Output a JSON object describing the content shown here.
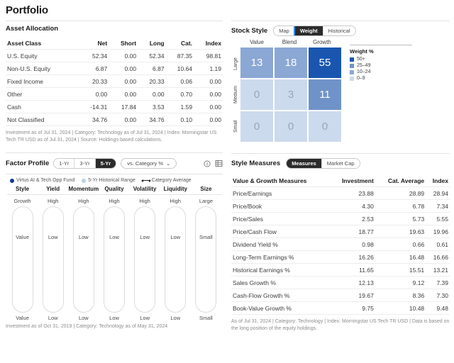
{
  "page": {
    "title": "Portfolio"
  },
  "asset_allocation": {
    "title": "Asset Allocation",
    "columns": [
      "Asset Class",
      "Net",
      "Short",
      "Long",
      "Cat.",
      "Index"
    ],
    "rows": [
      {
        "label": "U.S. Equity",
        "net": "52.34",
        "short": "0.00",
        "long": "52.34",
        "cat": "87.35",
        "index": "98.81"
      },
      {
        "label": "Non-U.S. Equity",
        "net": "6.87",
        "short": "0.00",
        "long": "6.87",
        "cat": "10.64",
        "index": "1.19"
      },
      {
        "label": "Fixed Income",
        "net": "20.33",
        "short": "0.00",
        "long": "20.33",
        "cat": "0.06",
        "index": "0.00"
      },
      {
        "label": "Other",
        "net": "0.00",
        "short": "0.00",
        "long": "0.00",
        "cat": "0.70",
        "index": "0.00"
      },
      {
        "label": "Cash",
        "net": "-14.31",
        "short": "17.84",
        "long": "3.53",
        "cat": "1.59",
        "index": "0.00"
      },
      {
        "label": "Not Classified",
        "net": "34.76",
        "short": "0.00",
        "long": "34.76",
        "cat": "0.10",
        "index": "0.00"
      }
    ],
    "footnote": "Investment as of Jul 31, 2024 | Category: Technology as of Jul 31, 2024 | Index: Morningstar US Tech TR USD as of Jul 31, 2024 | Source: Holdings-based calculations."
  },
  "stock_style": {
    "title": "Stock Style",
    "tabs": [
      {
        "label": "Map",
        "active": false
      },
      {
        "label": "Weight",
        "active": true
      },
      {
        "label": "Historical",
        "active": false
      }
    ],
    "col_headers": [
      "Value",
      "Blend",
      "Growth"
    ],
    "row_headers": [
      "Large",
      "Medium",
      "Small"
    ],
    "cells": [
      [
        {
          "value": "13",
          "tier": 1
        },
        {
          "value": "18",
          "tier": 1
        },
        {
          "value": "55",
          "tier": 3
        }
      ],
      [
        {
          "value": "0",
          "tier": 0
        },
        {
          "value": "3",
          "tier": 0
        },
        {
          "value": "11",
          "tier": 2
        }
      ],
      [
        {
          "value": "0",
          "tier": 0
        },
        {
          "value": "0",
          "tier": 0
        },
        {
          "value": "0",
          "tier": 0
        }
      ]
    ],
    "legend": {
      "title": "Weight %",
      "items": [
        {
          "label": "50+",
          "color": "#1a56b0"
        },
        {
          "label": "25–49",
          "color": "#6f93c9"
        },
        {
          "label": "10–24",
          "color": "#8ba7d4"
        },
        {
          "label": "0–9",
          "color": "#ccdaee"
        }
      ]
    }
  },
  "factor_profile": {
    "title": "Factor Profile",
    "period_tabs": [
      {
        "label": "1-Yr",
        "active": false
      },
      {
        "label": "3-Yr",
        "active": false
      },
      {
        "label": "5-Yr",
        "active": true
      }
    ],
    "compare_select": "vs. Category %",
    "chevron": "⌄",
    "legend": [
      {
        "label": "Virtus AI & Tech Opp Fund",
        "marker": "dot-dark"
      },
      {
        "label": "5-Yr Historical Range",
        "marker": "dot-light"
      },
      {
        "label": "Category Average",
        "marker": "line"
      }
    ],
    "columns": [
      {
        "name": "Style",
        "top": "Growth",
        "bottom": "Value"
      },
      {
        "name": "Yield",
        "top": "High",
        "bottom": "Low"
      },
      {
        "name": "Momentum",
        "top": "High",
        "bottom": "Low"
      },
      {
        "name": "Quality",
        "top": "High",
        "bottom": "Low"
      },
      {
        "name": "Volatility",
        "top": "High",
        "bottom": "Low"
      },
      {
        "name": "Liquidity",
        "top": "High",
        "bottom": "Low"
      },
      {
        "name": "Size",
        "top": "Large",
        "bottom": "Small"
      }
    ],
    "footnote": "Investment as of Oct 31, 2019 | Category: Technology as of May 31, 2024"
  },
  "style_measures": {
    "title": "Style Measures",
    "tabs": [
      {
        "label": "Measures",
        "active": true
      },
      {
        "label": "Market Cap",
        "active": false
      }
    ],
    "columns": [
      "Value & Growth Measures",
      "Investment",
      "Cat. Average",
      "Index"
    ],
    "rows": [
      {
        "label": "Price/Earnings",
        "investment": "23.88",
        "cat": "28.89",
        "index": "28.94"
      },
      {
        "label": "Price/Book",
        "investment": "4.30",
        "cat": "6.78",
        "index": "7.34"
      },
      {
        "label": "Price/Sales",
        "investment": "2.53",
        "cat": "5.73",
        "index": "5.55"
      },
      {
        "label": "Price/Cash Flow",
        "investment": "18.77",
        "cat": "19.63",
        "index": "19.96"
      },
      {
        "label": "Dividend Yield %",
        "investment": "0.98",
        "cat": "0.66",
        "index": "0.61"
      },
      {
        "label": "Long-Term Earnings %",
        "investment": "16.26",
        "cat": "16.48",
        "index": "16.66"
      },
      {
        "label": "Historical Earnings %",
        "investment": "11.65",
        "cat": "15.51",
        "index": "13.21"
      },
      {
        "label": "Sales Growth %",
        "investment": "12.13",
        "cat": "9.12",
        "index": "7.39"
      },
      {
        "label": "Cash-Flow Growth %",
        "investment": "19.67",
        "cat": "8.36",
        "index": "7.30"
      },
      {
        "label": "Book-Value Growth %",
        "investment": "9.75",
        "cat": "10.48",
        "index": "9.48"
      }
    ],
    "footnote": "As of Jul 31, 2024 | Category: Technology | Index: Morningstar US Tech TR USD | Data is based on the long position of the equity holdings."
  }
}
